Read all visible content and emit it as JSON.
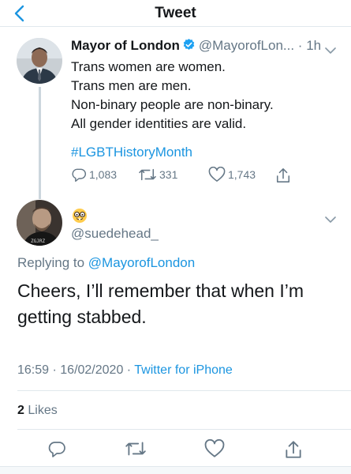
{
  "header": {
    "title": "Tweet"
  },
  "parent_tweet": {
    "name": "Mayor of London",
    "handle": "@MayorofLon...",
    "time": "1h",
    "lines": [
      "Trans women are women.",
      "Trans men are men.",
      "Non-binary people are non-binary.",
      "All gender identities are valid."
    ],
    "hashtag": "#LGBTHistoryMonth",
    "replies": "1,083",
    "retweets": "331",
    "likes": "1,743"
  },
  "reply_tweet": {
    "handle": "@suedehead_",
    "emoji": "nerd-face-emoji",
    "replying_prefix": "Replying to",
    "replying_to": "@MayorofLondon",
    "lines": [
      "Cheers, I’ll remember that when I’m",
      "getting stabbed."
    ],
    "time": "16:59",
    "date": "16/02/2020",
    "source": "Twitter for iPhone",
    "likes_count": "2",
    "likes_label": "Likes"
  },
  "colors": {
    "link": "#1b95e0",
    "secondary": "#657786",
    "divider": "#e1e8ed"
  }
}
